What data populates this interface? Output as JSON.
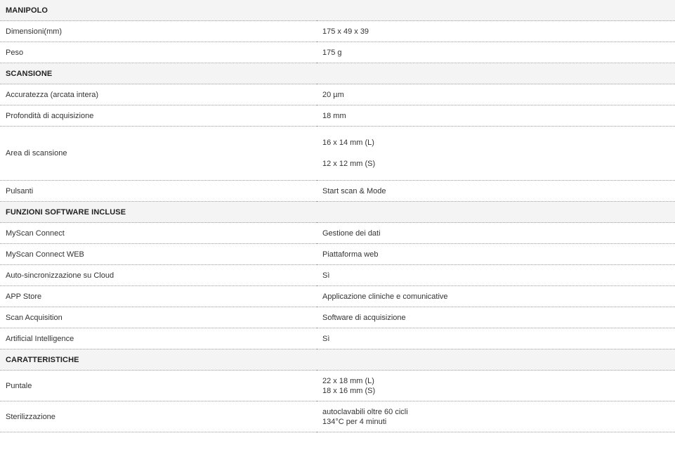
{
  "sections": [
    {
      "title": "MANIPOLO",
      "rows": [
        {
          "label": "Dimensioni(mm)",
          "value": "175 x 49 x 39"
        },
        {
          "label": "Peso",
          "value": "175 g"
        }
      ]
    },
    {
      "title": "SCANSIONE",
      "rows": [
        {
          "label": "Accuratezza (arcata intera)",
          "value": "20 µm"
        },
        {
          "label": "Profondità di acquisizione",
          "value": "18 mm"
        },
        {
          "label": "Area di scansione",
          "values": [
            "16 x 14 mm (L)",
            "12 x 12 mm (S)"
          ]
        },
        {
          "label": "Pulsanti",
          "value": "Start scan & Mode"
        }
      ]
    },
    {
      "title": "FUNZIONI SOFTWARE INCLUSE",
      "rows": [
        {
          "label": "MyScan Connect",
          "value": "Gestione dei dati"
        },
        {
          "label": "MyScan Connect WEB",
          "value": "Piattaforma web"
        },
        {
          "label": "Auto-sincronizzazione su Cloud",
          "value": "Sì"
        },
        {
          "label": "APP Store",
          "value": "Applicazione cliniche e comunicative"
        },
        {
          "label": "Scan Acquisition",
          "value": "Software di acquisizione"
        },
        {
          "label": "Artificial Intelligence",
          "value": "Sì"
        }
      ]
    },
    {
      "title": "CARATTERISTICHE",
      "rows": [
        {
          "label": "Puntale",
          "values": [
            "22 x 18 mm (L)",
            "18 x 16 mm (S)"
          ]
        },
        {
          "label": "Sterilizzazione",
          "values": [
            "autoclavabili oltre 60 cicli",
            "134°C per 4 minuti"
          ]
        }
      ]
    }
  ]
}
